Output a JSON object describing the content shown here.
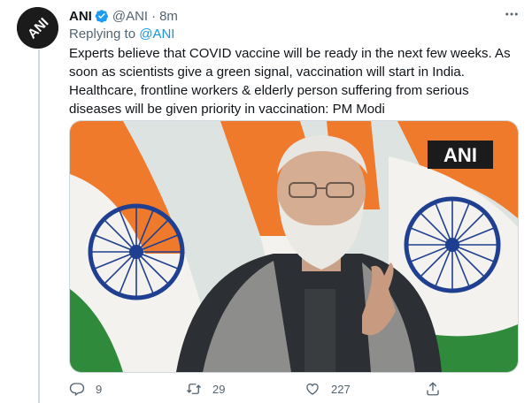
{
  "tweet": {
    "author": {
      "name": "ANI",
      "handle": "@ANI",
      "avatar_text": "ANI",
      "verified": true
    },
    "separator": "·",
    "time": "8m",
    "replying_to": {
      "label": "Replying to",
      "mention": "@ANI"
    },
    "text": "Experts believe that COVID vaccine will be ready in the next few weeks. As soon as scientists give a green signal, vaccination will start in India. Healthcare, frontline workers & elderly person suffering from serious diseases will be given priority in vaccination: PM Modi",
    "media": {
      "watermark": "ANI"
    },
    "actions": {
      "reply": {
        "icon": "reply-icon",
        "count": "9"
      },
      "retweet": {
        "icon": "retweet-icon",
        "count": "29"
      },
      "like": {
        "icon": "heart-icon",
        "count": "227"
      },
      "share": {
        "icon": "share-icon"
      }
    },
    "more_icon": "more-options-icon"
  },
  "colors": {
    "text": "#0f1419",
    "secondary": "#536471",
    "link": "#1b95e0",
    "verified": "#1d9bf0",
    "saffron": "#f07a2b",
    "flag_green": "#2f8a3c",
    "chakra": "#1f3f91"
  }
}
